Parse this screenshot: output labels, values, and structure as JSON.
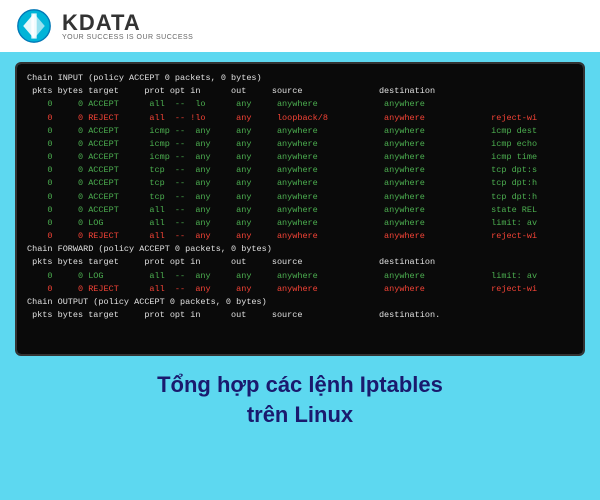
{
  "header": {
    "brand": "KDATA",
    "tagline": "YOUR SUCCESS IS OUR SUCCESS"
  },
  "terminal": {
    "lines": [
      {
        "text": "Chain INPUT (policy ACCEPT 0 packets, 0 bytes)",
        "color": "white"
      },
      {
        "text": " pkts bytes target     prot opt in      out     source               destination",
        "color": "white"
      },
      {
        "text": "    0     0 ACCEPT      all  --  lo      any     anywhere             anywhere",
        "color": "green"
      },
      {
        "text": "    0     0 REJECT      all  -- !lo      any     loopback/8           anywhere             reject-wi",
        "color": "red"
      },
      {
        "text": "    0     0 ACCEPT      icmp --  any     any     anywhere             anywhere             icmp dest",
        "color": "green"
      },
      {
        "text": "    0     0 ACCEPT      icmp --  any     any     anywhere             anywhere             icmp echo",
        "color": "green"
      },
      {
        "text": "    0     0 ACCEPT      icmp --  any     any     anywhere             anywhere             icmp time",
        "color": "green"
      },
      {
        "text": "    0     0 ACCEPT      tcp  --  any     any     anywhere             anywhere             tcp dpt:s",
        "color": "green"
      },
      {
        "text": "    0     0 ACCEPT      tcp  --  any     any     anywhere             anywhere             tcp dpt:h",
        "color": "green"
      },
      {
        "text": "    0     0 ACCEPT      tcp  --  any     any     anywhere             anywhere             tcp dpt:h",
        "color": "green"
      },
      {
        "text": "    0     0 ACCEPT      all  --  any     any     anywhere             anywhere             state REL",
        "color": "green"
      },
      {
        "text": "    0     0 LOG         all  --  any     any     anywhere             anywhere             limit: av",
        "color": "green"
      },
      {
        "text": "    0     0 REJECT      all  --  any     any     anywhere             anywhere             reject-wi",
        "color": "red"
      },
      {
        "text": "",
        "color": "white"
      },
      {
        "text": "Chain FORWARD (policy ACCEPT 0 packets, 0 bytes)",
        "color": "white"
      },
      {
        "text": " pkts bytes target     prot opt in      out     source               destination",
        "color": "white"
      },
      {
        "text": "    0     0 LOG         all  --  any     any     anywhere             anywhere             limit: av",
        "color": "green"
      },
      {
        "text": "    0     0 REJECT      all  --  any     any     anywhere             anywhere             reject-wi",
        "color": "red"
      },
      {
        "text": "",
        "color": "white"
      },
      {
        "text": "Chain OUTPUT (policy ACCEPT 0 packets, 0 bytes)",
        "color": "white"
      },
      {
        "text": " pkts bytes target     prot opt in      out     source               destination.",
        "color": "white"
      }
    ]
  },
  "page_title_line1": "Tổng hợp các lệnh Iptables",
  "page_title_line2": "trên Linux"
}
